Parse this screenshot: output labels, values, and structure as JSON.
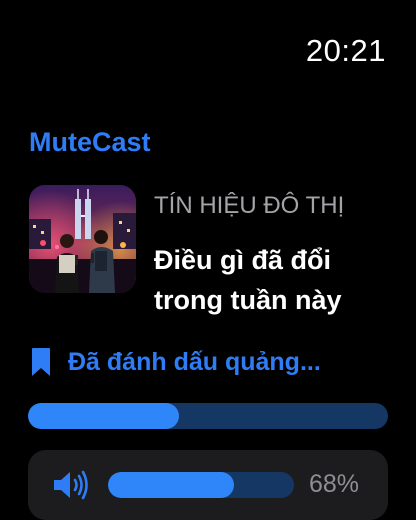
{
  "status_bar": {
    "time": "20:21"
  },
  "app": {
    "title": "MuteCast"
  },
  "now_playing": {
    "artwork_icon": "podcast-artwork-city-night",
    "show_name": "TÍN HIỆU ĐÔ THỊ",
    "episode_title": "Điều gì đã đổi trong tuần này"
  },
  "bookmark": {
    "icon": "bookmark-icon",
    "label": "Đã đánh dấu quảng..."
  },
  "playback": {
    "progress_fraction": 0.42
  },
  "volume": {
    "icon": "speaker-icon",
    "level_percent": 68,
    "label": "68%"
  },
  "colors": {
    "accent": "#2f7df6",
    "track": "#143763",
    "panel": "#1c1c1e",
    "secondary_text": "#a3a3a8"
  }
}
